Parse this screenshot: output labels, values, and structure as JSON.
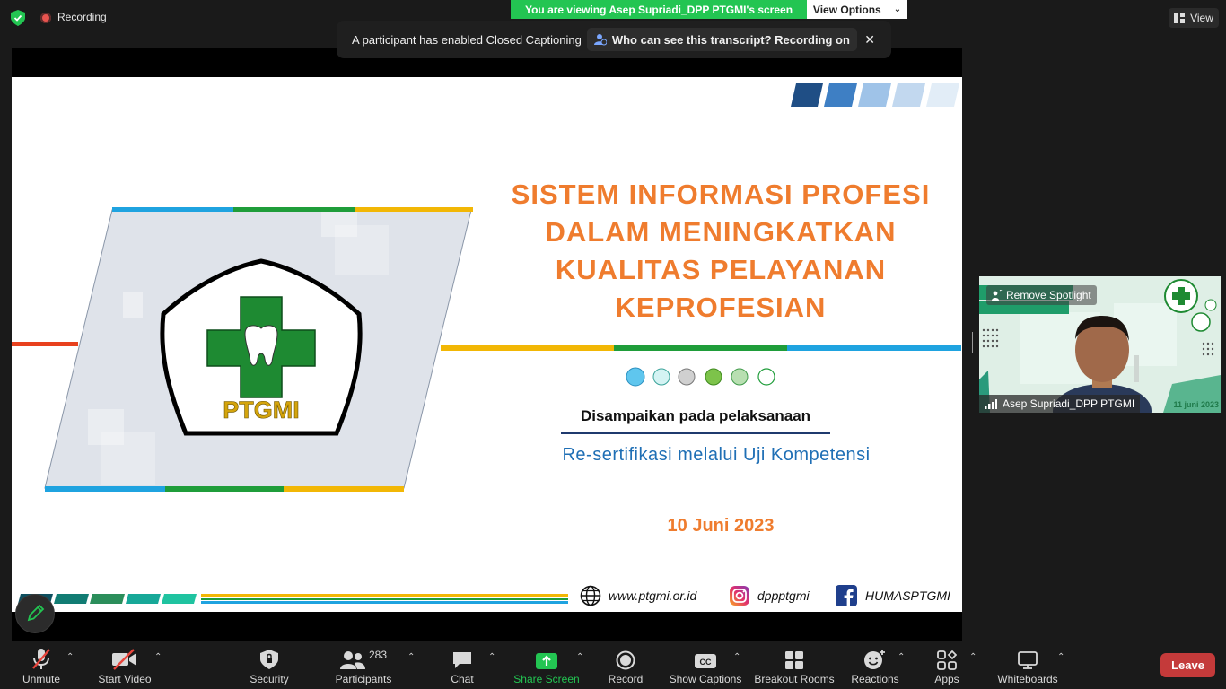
{
  "top": {
    "recording": "Recording",
    "viewing": "You are viewing Asep Supriadi_DPP PTGMI's screen",
    "view_options": "View Options",
    "view": "View"
  },
  "caption_banner": {
    "message": "A participant has enabled Closed Captioning",
    "question": "Who can see this transcript? Recording on"
  },
  "slide": {
    "title_lines": [
      "SISTEM INFORMASI PROFESI",
      "DALAM MENINGKATKAN",
      "KUALITAS PELAYANAN",
      "KEPROFESIAN"
    ],
    "logo_text": "PTGMI",
    "delivered": "Disampaikan pada pelaksanaan",
    "event": "Re-sertifikasi melalui Uji Kompetensi",
    "date": "10 Juni 2023",
    "website": "www.ptgmi.or.id",
    "instagram": "dppptgmi",
    "facebook": "HUMASPTGMI",
    "colors": {
      "orange": "#ef7c2e",
      "blue": "#1f6fb5",
      "green": "#1f9d3a"
    }
  },
  "self_video": {
    "spotlight": "Remove Spotlight",
    "name": "Asep Supriadi_DPP PTGMI",
    "bg_date": "11 juni 2023"
  },
  "toolbar": {
    "unmute": "Unmute",
    "start_video": "Start Video",
    "security": "Security",
    "participants": "Participants",
    "participant_count": "283",
    "chat": "Chat",
    "share_screen": "Share Screen",
    "record": "Record",
    "show_captions": "Show Captions",
    "breakout_rooms": "Breakout Rooms",
    "reactions": "Reactions",
    "apps": "Apps",
    "whiteboards": "Whiteboards",
    "leave": "Leave"
  }
}
